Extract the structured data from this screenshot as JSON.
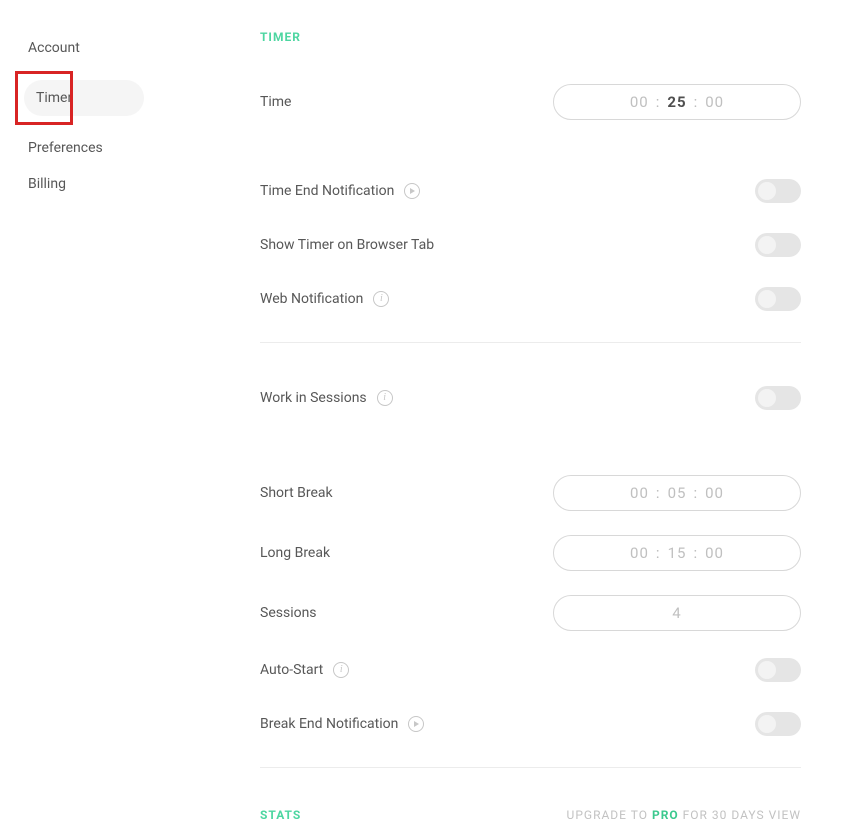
{
  "sidebar": {
    "items": [
      {
        "label": "Account"
      },
      {
        "label": "Timer"
      },
      {
        "label": "Preferences"
      },
      {
        "label": "Billing"
      }
    ]
  },
  "section_title": "TIMER",
  "rows": {
    "time": {
      "label": "Time",
      "hh": "00",
      "mm": "25",
      "ss": "00"
    },
    "time_end_notification": {
      "label": "Time End Notification"
    },
    "show_timer_tab": {
      "label": "Show Timer on Browser Tab"
    },
    "web_notification": {
      "label": "Web Notification"
    },
    "work_in_sessions": {
      "label": "Work in Sessions"
    },
    "short_break": {
      "label": "Short Break",
      "hh": "00",
      "mm": "05",
      "ss": "00"
    },
    "long_break": {
      "label": "Long Break",
      "hh": "00",
      "mm": "15",
      "ss": "00"
    },
    "sessions": {
      "label": "Sessions",
      "value": "4"
    },
    "auto_start": {
      "label": "Auto-Start"
    },
    "break_end_notification": {
      "label": "Break End Notification"
    }
  },
  "stats": {
    "title": "STATS",
    "upgrade_pre": "UPGRADE TO ",
    "upgrade_pro": "PRO",
    "upgrade_post": " FOR 30 DAYS VIEW"
  }
}
